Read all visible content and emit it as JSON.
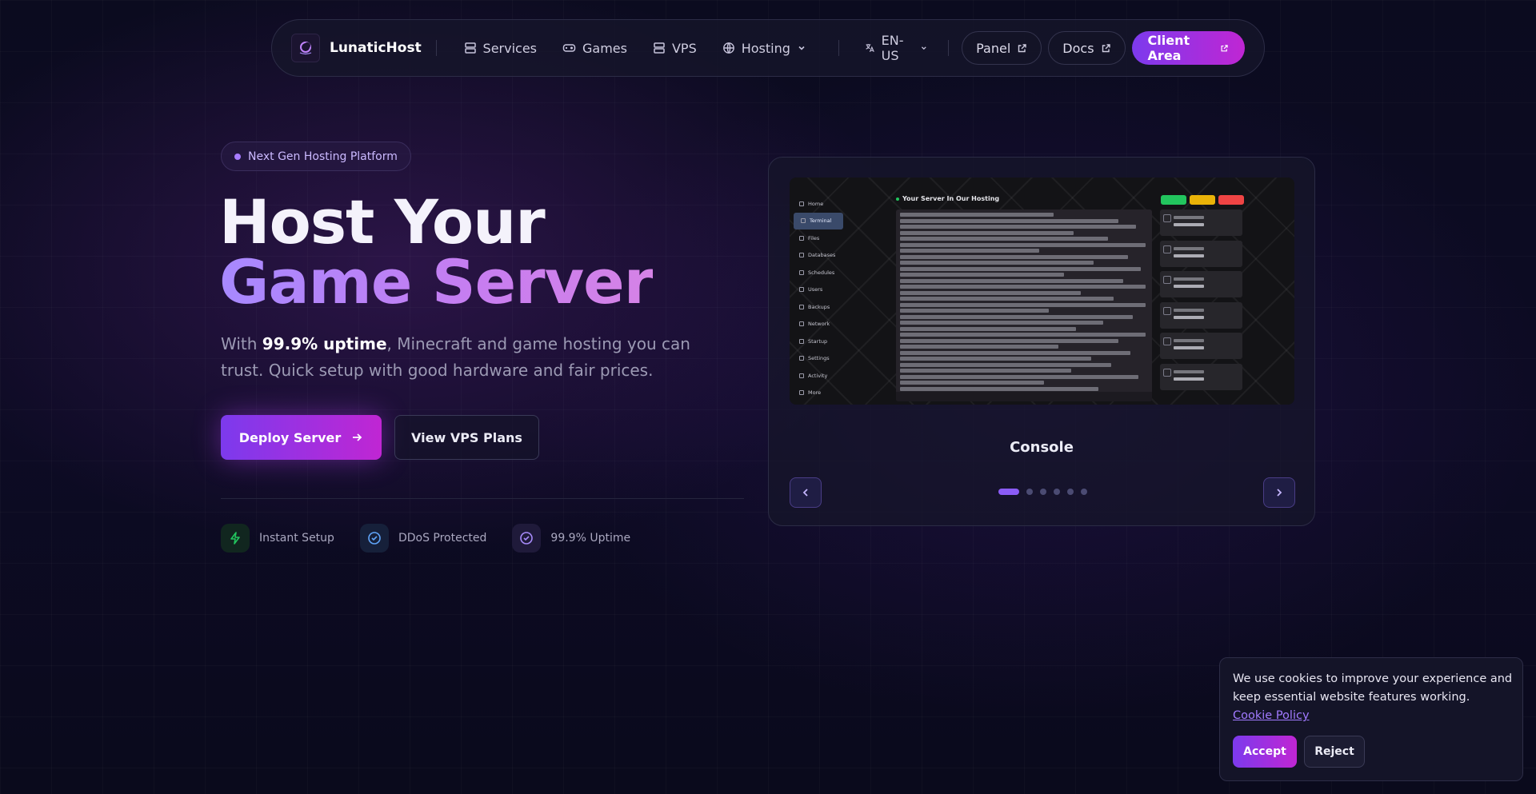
{
  "nav": {
    "brand": "LunaticHost",
    "items": [
      {
        "label": "Services",
        "icon": "server-icon"
      },
      {
        "label": "Games",
        "icon": "gamepad-icon"
      },
      {
        "label": "VPS",
        "icon": "server-icon"
      },
      {
        "label": "Hosting",
        "icon": "globe-icon"
      }
    ],
    "language": "EN-US",
    "panel_label": "Panel",
    "docs_label": "Docs",
    "client_area_label": "Client Area"
  },
  "hero": {
    "badge": "Next Gen Hosting Platform",
    "title_line1": "Host Your",
    "title_line2": "Game Server",
    "subtitle_prefix": "With ",
    "subtitle_highlight": "99.9% uptime",
    "subtitle_suffix": ", Minecraft and game hosting you can trust. Quick setup with good hardware and fair prices.",
    "primary_button": "Deploy Server",
    "secondary_button": "View VPS Plans",
    "features": [
      {
        "label": "Instant Setup",
        "icon": "bolt-icon",
        "color": "#22c55e"
      },
      {
        "label": "DDoS Protected",
        "icon": "check-circle-icon",
        "color": "#60a5fa"
      },
      {
        "label": "99.9% Uptime",
        "icon": "check-circle-icon",
        "color": "#a78bfa"
      }
    ]
  },
  "carousel": {
    "caption": "Console",
    "slide_count": 6,
    "active_index": 0,
    "preview": {
      "title": "Your Server In Our Hosting",
      "sidebar": [
        "Home",
        "Terminal",
        "Files",
        "Databases",
        "Schedules",
        "Users",
        "Backups",
        "Network",
        "Startup",
        "Settings",
        "Activity",
        "More"
      ],
      "active_sidebar": "Terminal"
    }
  },
  "cookie": {
    "text": "We use cookies to improve your experience and keep essential website features working. ",
    "link": "Cookie Policy",
    "accept": "Accept",
    "reject": "Reject"
  },
  "colors": {
    "accent_start": "#7c3aed",
    "accent_end": "#c026d3",
    "background": "#0b0b1f"
  }
}
